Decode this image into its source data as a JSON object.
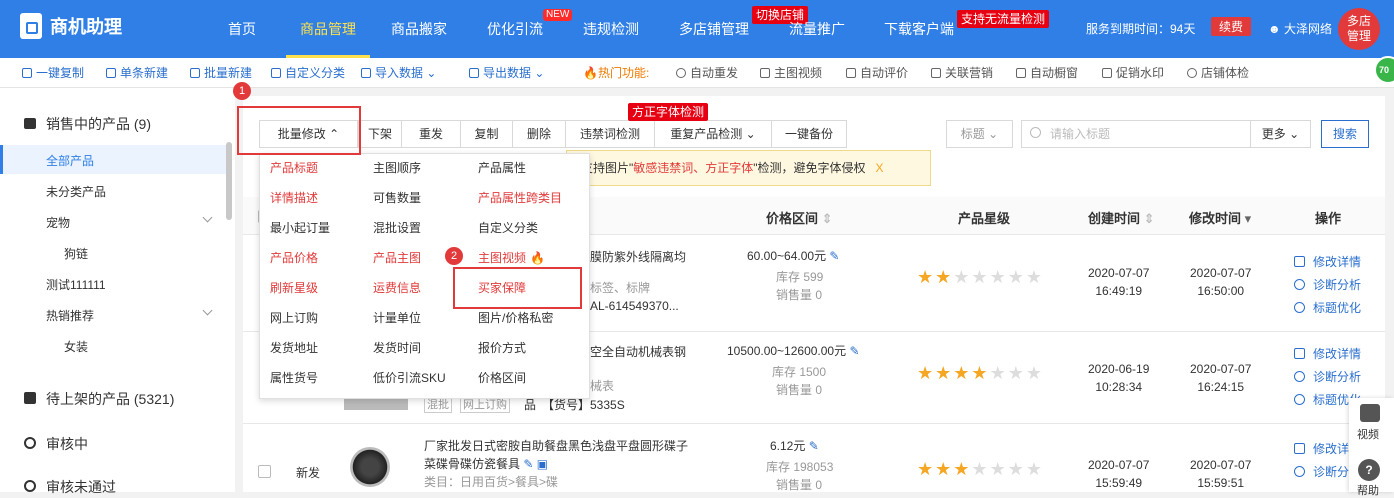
{
  "app": {
    "name": "商机助理"
  },
  "nav": {
    "items": [
      "首页",
      "商品管理",
      "商品搬家",
      "优化引流",
      "违规检测",
      "多店铺管理",
      "流量推广",
      "下载客户端"
    ],
    "new_badge": "NEW",
    "switch_store": "切换店铺",
    "no_traffic": "支持无流量检测",
    "service_time": "服务到期时间：94天",
    "renew": "续费",
    "user": "大泽网络",
    "multi_store": "多店\n管理"
  },
  "toolbar": {
    "items": [
      "一键复制",
      "单条新建",
      "批量新建",
      "自定义分类",
      "导入数据",
      "导出数据"
    ],
    "hot_label": "热门功能:",
    "features": [
      "自动重发",
      "主图视频",
      "自动评价",
      "关联营销",
      "自动橱窗",
      "促销水印",
      "店铺体检"
    ]
  },
  "badge_70": "70",
  "sidebar": {
    "selling": "销售中的产品 (9)",
    "items": [
      "全部产品",
      "未分类产品",
      "宠物",
      "狗链",
      "测试111111",
      "热销推荐",
      "女装",
      "..."
    ],
    "pending": "待上架的产品 (5321)",
    "reviewing": "审核中",
    "failed": "审核未通过"
  },
  "actions": {
    "bulk_edit": "批量修改",
    "buttons": [
      "下架",
      "重发",
      "复制",
      "删除",
      "违禁词检测",
      "重复产品检测",
      "一键备份"
    ],
    "font_check": "方正字体检测",
    "title_select": "标题",
    "search_placeholder": "请输入标题",
    "more": "更多",
    "search": "搜索"
  },
  "markers": {
    "one": "1",
    "two": "2"
  },
  "tip": {
    "pre": "支持图片\"",
    "red": "敏感违禁词、方正字体",
    "post": "\"检测，避免字体侵权",
    "close": "X"
  },
  "menu": [
    [
      "产品标题",
      "主图顺序",
      "产品属性"
    ],
    [
      "详情描述",
      "可售数量",
      "产品属性跨类目"
    ],
    [
      "最小起订量",
      "混批设置",
      "自定义分类"
    ],
    [
      "产品价格",
      "产品主图",
      "主图视频"
    ],
    [
      "刷新星级",
      "运费信息",
      "买家保障"
    ],
    [
      "网上订购",
      "计量单位",
      "图片/价格私密"
    ],
    [
      "发货地址",
      "发货时间",
      "报价方式"
    ],
    [
      "属性货号",
      "低价引流SKU",
      "价格区间"
    ]
  ],
  "table": {
    "headers": [
      "价格区间",
      "产品星级",
      "创建时间",
      "修改时间",
      "操作"
    ],
    "rows": [
      {
        "title": "膜防紫外线隔离均",
        "sub": "标签、标牌",
        "code": "AL-614549370...",
        "price": "60.00~64.00元",
        "stock": "库存 599",
        "sold": "销售量 0",
        "stars": 2,
        "created": [
          "2020-07-07",
          "16:49:19"
        ],
        "modified": [
          "2020-07-07",
          "16:50:00"
        ]
      },
      {
        "title": "空全自动机械表钢",
        "sub": "械表",
        "code": "【货号】5335S",
        "tags": [
          "混批",
          "网上订购",
          "品"
        ],
        "price": "10500.00~12600.00元",
        "stock": "库存 1500",
        "sold": "销售量 0",
        "stars": 4,
        "created": [
          "2020-06-19",
          "10:28:34"
        ],
        "modified": [
          "2020-07-07",
          "16:24:15"
        ]
      },
      {
        "status": "新发",
        "title": "厂家批发日式密胺自助餐盘黑色浅盘平盘圆形碟子",
        "title2": "菜碟骨碟仿瓷餐具",
        "category": "类目：日用百货>餐具>碟",
        "price": "6.12元",
        "stock": "库存 198053",
        "sold": "销售量 0",
        "stars": 3,
        "created": [
          "2020-07-07",
          "15:59:49"
        ],
        "modified": [
          "2020-07-07",
          "15:59:51"
        ]
      }
    ],
    "ops": [
      "修改详情",
      "诊断分析",
      "标题优化"
    ]
  },
  "float": {
    "video": "视频",
    "help": "帮助"
  }
}
